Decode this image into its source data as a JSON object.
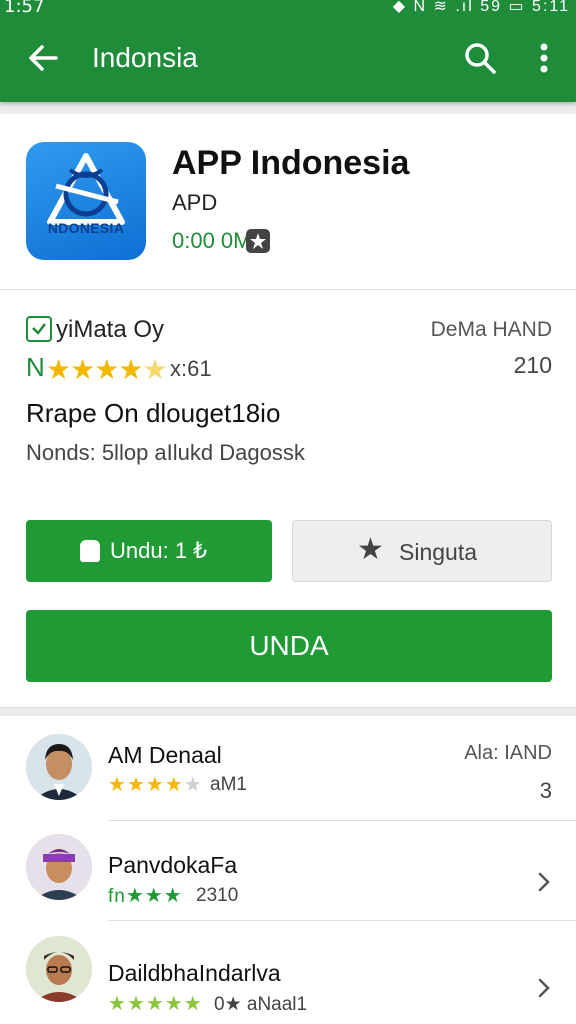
{
  "status_bar": {
    "time": "1:57",
    "icons": "◆ N ≋ .ıl 59 ▭ 5:11"
  },
  "toolbar": {
    "title": "Indonsia"
  },
  "app": {
    "icon_text": "NDONESIA",
    "title": "APP Indonesia",
    "developer": "APD",
    "size": "0:00 0M"
  },
  "info": {
    "row1_left": "yiMata Oy",
    "row1_right": "DeMa HAND",
    "rating_prefix": "N",
    "rating_count": "x:61",
    "row2_right": "210",
    "headline": "Rrape On dlouget18io",
    "subline": "Nonds: 5llop aIlukd Dagossk"
  },
  "buttons": {
    "install_label": "Undu: 1 ₺",
    "wishlist_label": "Singuta",
    "main_label": "UNDA"
  },
  "reviews": [
    {
      "name": "AM Denaal",
      "count": "aM1",
      "meta": "Ala: IAND",
      "num": "3"
    },
    {
      "name": "PanvdokaFa",
      "prefix": "fn",
      "count": "2310"
    },
    {
      "name": "DaildbhaIndarlva",
      "count": "0★ aNaal1"
    }
  ],
  "colors": {
    "primary": "#1f8c3a",
    "button_green": "#1f9a35",
    "star": "#f5b800"
  },
  "icons": [
    "back-arrow-icon",
    "search-icon",
    "more-vert-icon",
    "download-icon",
    "star-icon",
    "chevron-right-icon"
  ]
}
